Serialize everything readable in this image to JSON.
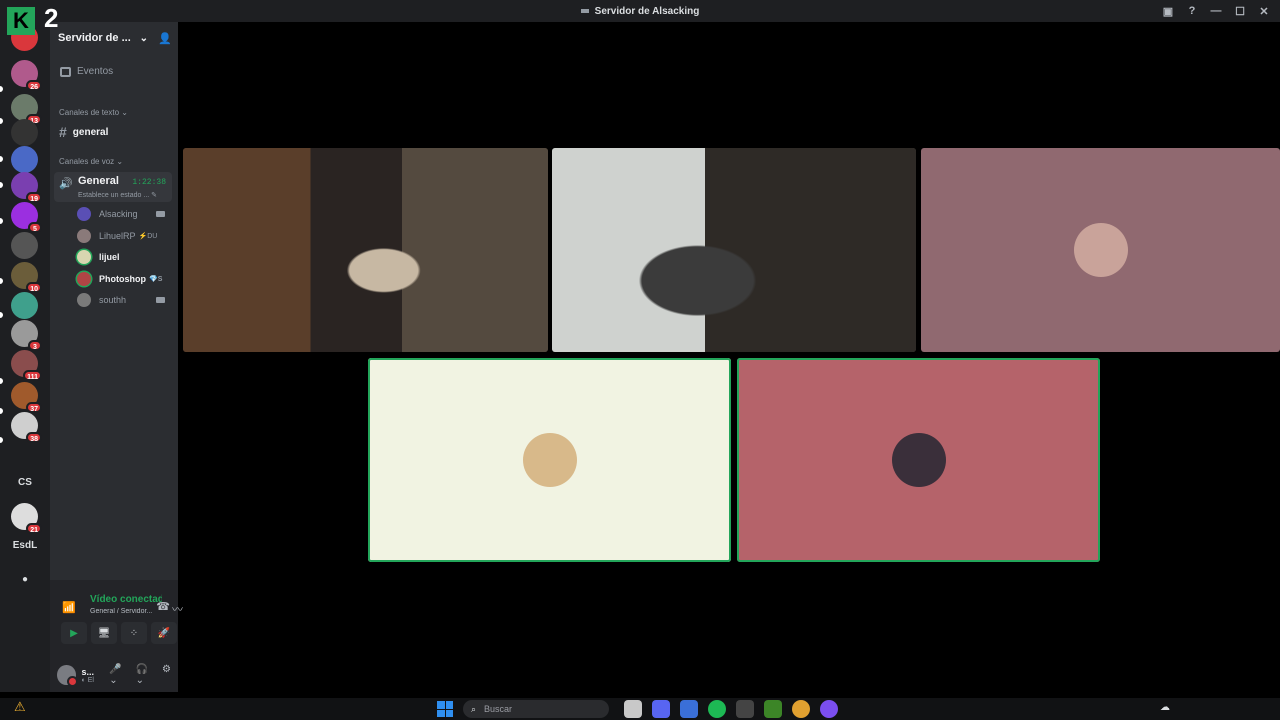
{
  "window": {
    "title": "Servidor de Alsacking",
    "controls": [
      "▣",
      "?",
      "—",
      "☐",
      "✕"
    ]
  },
  "overlay": {
    "badge_label": "K",
    "counter": "2"
  },
  "guilds": [
    {
      "badge": "26",
      "color": "#b05a8c"
    },
    {
      "badge": "13",
      "color": "#6b7b6a"
    },
    {
      "badge": "",
      "color": "#333333"
    },
    {
      "badge": "",
      "color": "#4a69c6"
    },
    {
      "badge": "19",
      "color": "#7a3fb0"
    },
    {
      "badge": "5",
      "color": "#9b2fe0"
    },
    {
      "badge": "",
      "color": "#555555"
    },
    {
      "badge": "10",
      "color": "#6b5d3a"
    },
    {
      "badge": "",
      "color": "#3fa08c"
    },
    {
      "badge": "3",
      "color": "#9a9a9a"
    },
    {
      "badge": "111",
      "color": "#8a4d4d"
    },
    {
      "badge": "37",
      "color": "#a05a2c"
    },
    {
      "badge": "38",
      "color": "#cfcfcf"
    }
  ],
  "guild_text_items": [
    {
      "label": "CS"
    },
    {
      "badge": "21"
    },
    {
      "label": "EsdL"
    }
  ],
  "sidebar": {
    "server_name": "Servidor de ...",
    "chevron": "⌄",
    "add_user_icon": "👤",
    "events_label": "Eventos",
    "text_category": "Canales de texto ⌄",
    "general_text_channel": "general",
    "voice_category": "Canales de voz ⌄",
    "voice_channel": {
      "name": "General",
      "timer": "1:22:38",
      "status": "Establece un estado ... ✎"
    },
    "voice_users": [
      {
        "name": "Alsacking",
        "extra": "",
        "camera": true,
        "bright": false,
        "speaking": false,
        "color": "#5a4fb5"
      },
      {
        "name": "LihuelRP",
        "extra": "⚡DU",
        "camera": false,
        "bright": false,
        "speaking": false,
        "color": "#8a7a7a"
      },
      {
        "name": "lijuel",
        "extra": "",
        "camera": false,
        "bright": true,
        "speaking": true,
        "color": "#d8d6b0"
      },
      {
        "name": "Photoshop",
        "extra": "💎S",
        "camera": false,
        "bright": true,
        "speaking": true,
        "color": "#b04545"
      },
      {
        "name": "southh",
        "extra": "",
        "camera": true,
        "bright": false,
        "speaking": false,
        "color": "#7a7a7a"
      }
    ]
  },
  "voice_panel": {
    "title": "Vídeo conectad",
    "subtitle": "General / Servidor...",
    "buttons": [
      "▶",
      "🖥",
      "⁘",
      "🚀"
    ]
  },
  "user": {
    "name": "s...",
    "status": "◐ El"
  },
  "tiles": [
    {
      "kind": "video",
      "bg": "#3e2c20",
      "speaking": false
    },
    {
      "kind": "video",
      "bg": "#4a4640",
      "speaking": false
    },
    {
      "kind": "avatar",
      "bg": "#906970",
      "avatar_color": "#c9a39a",
      "speaking": false
    },
    {
      "kind": "avatar",
      "bg": "#f1f3e2",
      "avatar_color": "#d8b98a",
      "speaking": true
    },
    {
      "kind": "avatar",
      "bg": "#b5636a",
      "avatar_color": "#3a2f3a",
      "speaking": true
    }
  ],
  "taskbar": {
    "search_placeholder": "Buscar",
    "warning_icon": "⚠",
    "tray_icon": "☁"
  },
  "colors": {
    "online_green": "#23a55a",
    "danger_red": "#da373c",
    "bg_dark": "#1e1f22",
    "sidebar": "#2b2d31"
  }
}
